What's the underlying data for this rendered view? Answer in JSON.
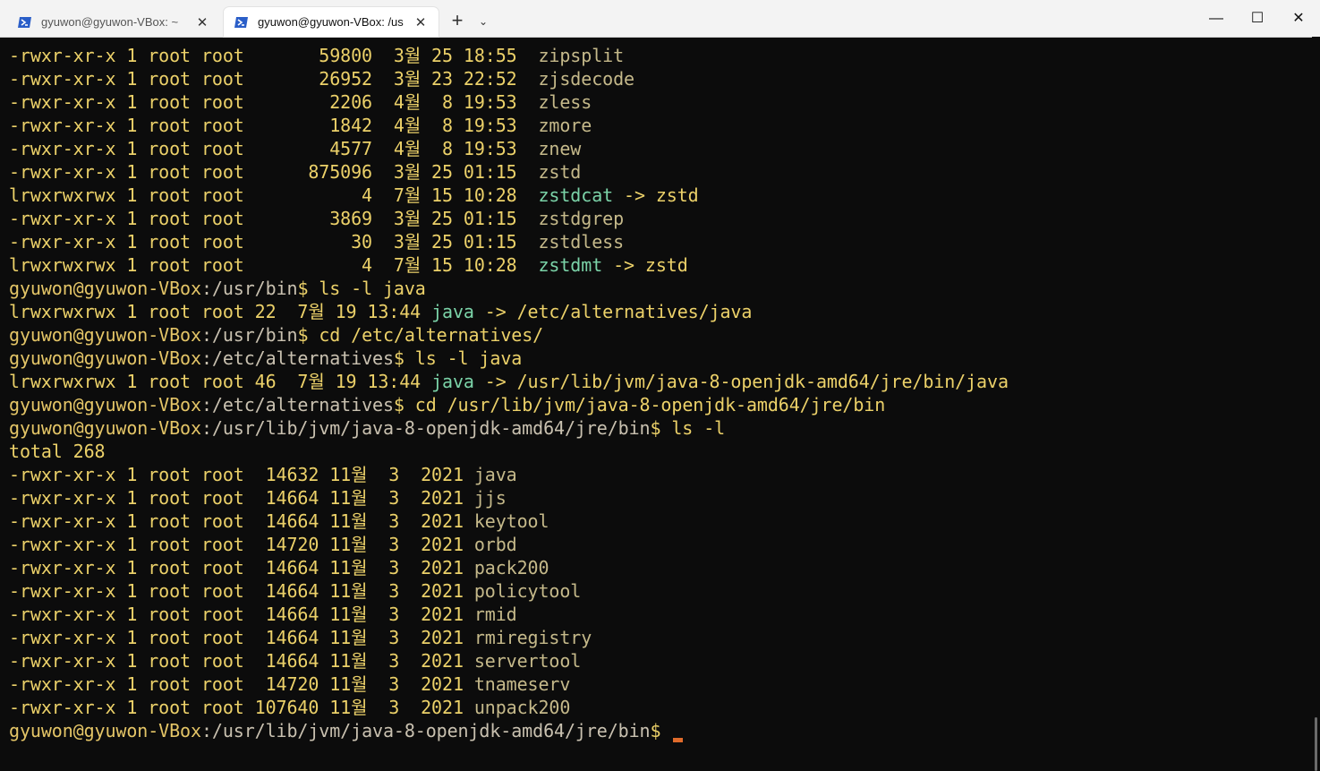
{
  "window": {
    "tabs": [
      {
        "label": "gyuwon@gyuwon-VBox: ~",
        "icon": "powershell-icon",
        "active": false
      },
      {
        "label": "gyuwon@gyuwon-VBox: /us",
        "icon": "powershell-icon",
        "active": true
      }
    ],
    "new_tab_label": "+",
    "dropdown_label": "⌄",
    "minimize_label": "—",
    "maximize_label": "☐",
    "close_label": "✕",
    "tab_close_label": "✕"
  },
  "colors": {
    "background": "#0c0c0c",
    "text": "#ecd169",
    "symlink": "#7bd3a8",
    "path": "#c9c1b0",
    "cursor": "#e06b2b"
  },
  "terminal": {
    "lines": [
      {
        "perm": "-rwxr-xr-x 1 root root       59800  3월 25 18:55  ",
        "name": "zipsplit"
      },
      {
        "perm": "-rwxr-xr-x 1 root root       26952  3월 23 22:52  ",
        "name": "zjsdecode"
      },
      {
        "perm": "-rwxr-xr-x 1 root root        2206  4월  8 19:53  ",
        "name": "zless"
      },
      {
        "perm": "-rwxr-xr-x 1 root root        1842  4월  8 19:53  ",
        "name": "zmore"
      },
      {
        "perm": "-rwxr-xr-x 1 root root        4577  4월  8 19:53  ",
        "name": "znew"
      },
      {
        "perm": "-rwxr-xr-x 1 root root      875096  3월 25 01:15  ",
        "name": "zstd"
      },
      {
        "perm": "lrwxrwxrwx 1 root root           4  7월 15 10:28  ",
        "link": "zstdcat",
        "target": " -> zstd"
      },
      {
        "perm": "-rwxr-xr-x 1 root root        3869  3월 25 01:15  ",
        "name": "zstdgrep"
      },
      {
        "perm": "-rwxr-xr-x 1 root root          30  3월 25 01:15  ",
        "name": "zstdless"
      },
      {
        "perm": "lrwxrwxrwx 1 root root           4  7월 15 10:28  ",
        "link": "zstdmt",
        "target": " -> zstd"
      },
      {
        "user": "gyuwon@gyuwon-VBox",
        "path": ":/usr/bin",
        "cmd": "$ ls -l java"
      },
      {
        "perm": "lrwxrwxrwx 1 root root 22  7월 19 13:44 ",
        "link": "java",
        "target": " -> /etc/alternatives/java"
      },
      {
        "user": "gyuwon@gyuwon-VBox",
        "path": ":/usr/bin",
        "cmd": "$ cd /etc/alternatives/"
      },
      {
        "user": "gyuwon@gyuwon-VBox",
        "path": ":/etc/alternatives",
        "cmd": "$ ls -l java"
      },
      {
        "perm": "lrwxrwxrwx 1 root root 46  7월 19 13:44 ",
        "link": "java",
        "target": " -> /usr/lib/jvm/java-8-openjdk-amd64/jre/bin/java"
      },
      {
        "user": "gyuwon@gyuwon-VBox",
        "path": ":/etc/alternatives",
        "cmd": "$ cd /usr/lib/jvm/java-8-openjdk-amd64/jre/bin"
      },
      {
        "user": "gyuwon@gyuwon-VBox",
        "path": ":/usr/lib/jvm/java-8-openjdk-amd64/jre/bin",
        "cmd": "$ ls -l"
      },
      {
        "plain": "total 268"
      },
      {
        "perm": "-rwxr-xr-x 1 root root  14632 11월  3  2021 ",
        "name": "java"
      },
      {
        "perm": "-rwxr-xr-x 1 root root  14664 11월  3  2021 ",
        "name": "jjs"
      },
      {
        "perm": "-rwxr-xr-x 1 root root  14664 11월  3  2021 ",
        "name": "keytool"
      },
      {
        "perm": "-rwxr-xr-x 1 root root  14720 11월  3  2021 ",
        "name": "orbd"
      },
      {
        "perm": "-rwxr-xr-x 1 root root  14664 11월  3  2021 ",
        "name": "pack200"
      },
      {
        "perm": "-rwxr-xr-x 1 root root  14664 11월  3  2021 ",
        "name": "policytool"
      },
      {
        "perm": "-rwxr-xr-x 1 root root  14664 11월  3  2021 ",
        "name": "rmid"
      },
      {
        "perm": "-rwxr-xr-x 1 root root  14664 11월  3  2021 ",
        "name": "rmiregistry"
      },
      {
        "perm": "-rwxr-xr-x 1 root root  14664 11월  3  2021 ",
        "name": "servertool"
      },
      {
        "perm": "-rwxr-xr-x 1 root root  14720 11월  3  2021 ",
        "name": "tnameserv"
      },
      {
        "perm": "-rwxr-xr-x 1 root root 107640 11월  3  2021 ",
        "name": "unpack200"
      },
      {
        "user": "gyuwon@gyuwon-VBox",
        "path": ":/usr/lib/jvm/java-8-openjdk-amd64/jre/bin",
        "cmd": "$ ",
        "cursor": true
      }
    ]
  }
}
